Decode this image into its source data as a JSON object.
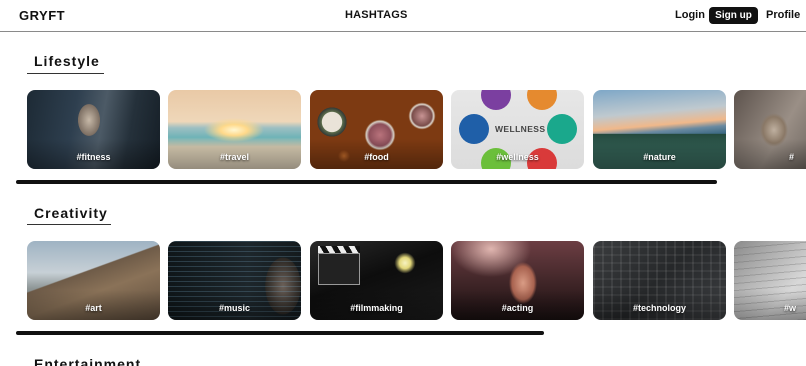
{
  "header": {
    "brand": "GRYFT",
    "title": "HASHTAGS",
    "login_label": "Login",
    "signup_label": "Sign up",
    "profile_label": "Profile"
  },
  "sections": [
    {
      "title": "Lifestyle",
      "cards": [
        {
          "tag": "#fitness",
          "image": "fitness-photo"
        },
        {
          "tag": "#travel",
          "image": "travel-photo"
        },
        {
          "tag": "#food",
          "image": "food-photo"
        },
        {
          "tag": "#wellness",
          "image": "wellness-graphic"
        },
        {
          "tag": "#nature",
          "image": "nature-photo"
        },
        {
          "tag": "#",
          "image": "cat-photo"
        }
      ]
    },
    {
      "title": "Creativity",
      "cards": [
        {
          "tag": "#art",
          "image": "art-photo"
        },
        {
          "tag": "#music",
          "image": "music-photo"
        },
        {
          "tag": "#filmmaking",
          "image": "filmmaking-photo"
        },
        {
          "tag": "#acting",
          "image": "acting-photo"
        },
        {
          "tag": "#technology",
          "image": "technology-photo"
        },
        {
          "tag": "#w",
          "image": "writing-photo"
        }
      ]
    },
    {
      "title": "Entertainment",
      "cards": []
    }
  ],
  "wellness_graphic": {
    "center_text": "WELLNESS",
    "colors": [
      "#7b3fa0",
      "#e58a2f",
      "#1f5fa8",
      "#1aa88c",
      "#6bbf3b",
      "#d93a3a"
    ]
  },
  "colors": {
    "accent": "#111111",
    "signup_bg": "#111111",
    "signup_text": "#ffffff"
  }
}
